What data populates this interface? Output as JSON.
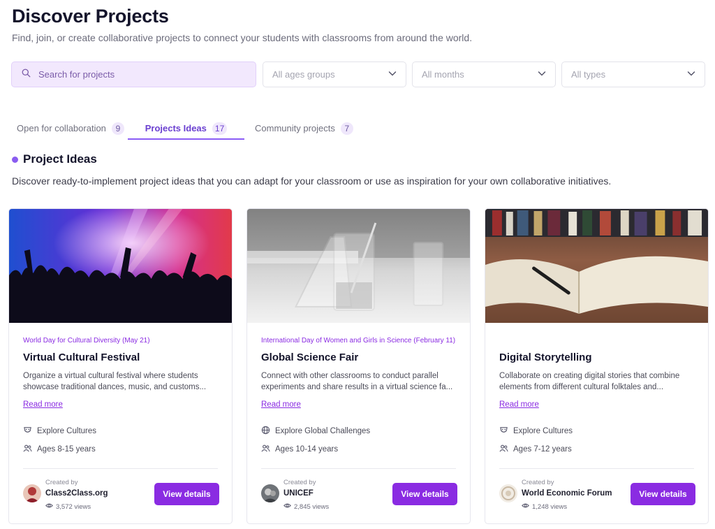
{
  "header": {
    "title": "Discover Projects",
    "subtitle": "Find, join, or create collaborative projects to connect your students with classrooms from around the world."
  },
  "filters": {
    "search_placeholder": "Search for projects",
    "ages": "All ages groups",
    "months": "All months",
    "types": "All types"
  },
  "tabs": [
    {
      "label": "Open for collaboration",
      "count": "9"
    },
    {
      "label": "Projects Ideas",
      "count": "17",
      "active": true
    },
    {
      "label": "Community projects",
      "count": "7"
    }
  ],
  "section": {
    "title": "Project Ideas",
    "description": "Discover ready-to-implement project ideas that you can adapt for your classroom or use as inspiration for your own collaborative initiatives."
  },
  "cards": [
    {
      "event": "World Day for Cultural Diversity (May 21)",
      "title": "Virtual Cultural Festival",
      "description": "Organize a virtual cultural festival where students showcase traditional dances, music, and customs...",
      "read_more": "Read more",
      "category": "Explore Cultures",
      "ages": "Ages 8-15 years",
      "created_by_label": "Created by",
      "creator": "Class2Class.org",
      "views": "3,572 views",
      "button": "View details"
    },
    {
      "event": "International Day of Women and Girls in Science (February 11)",
      "title": "Global Science Fair",
      "description": "Connect with other classrooms to conduct parallel experiments and share results in a virtual science fa...",
      "read_more": "Read more",
      "category": "Explore Global Challenges",
      "ages": "Ages 10-14 years",
      "created_by_label": "Created by",
      "creator": "UNICEF",
      "views": "2,845 views",
      "button": "View details"
    },
    {
      "event": "",
      "title": "Digital Storytelling",
      "description": "Collaborate on creating digital stories that combine elements from different cultural folktales and...",
      "read_more": "Read more",
      "category": "Explore Cultures",
      "ages": "Ages 7-12 years",
      "created_by_label": "Created by",
      "creator": "World Economic Forum",
      "views": "1,248 views",
      "button": "View details"
    }
  ],
  "colors": {
    "accent": "#8a2be2",
    "accent_light": "#f2e8fd",
    "tab_active": "#6a3fd0"
  }
}
